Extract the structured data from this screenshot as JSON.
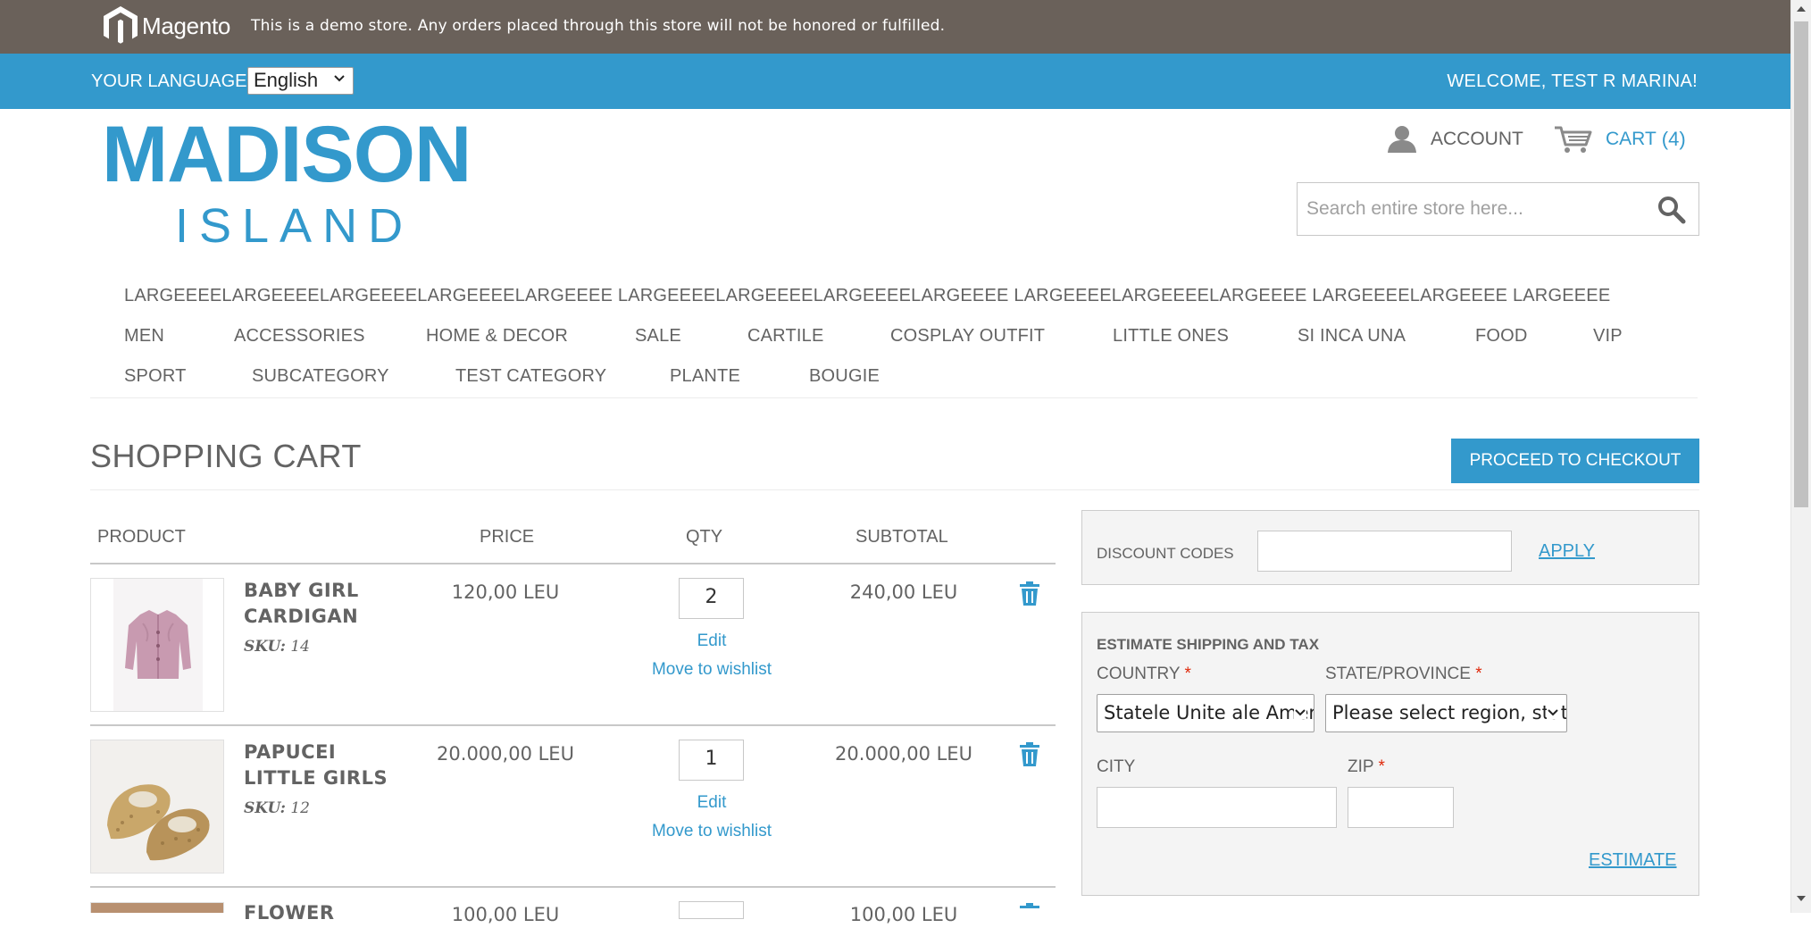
{
  "demo_notice": {
    "logo_text": "Magento",
    "message": "This is a demo store. Any orders placed through this store will not be honored or fulfilled."
  },
  "language_bar": {
    "label": "YOUR LANGUAGE:",
    "selected_language": "English",
    "welcome": "WELCOME, TEST R MARINA!"
  },
  "header": {
    "logo_line1": "MADISON",
    "logo_line2": "ISLAND",
    "account_label": "ACCOUNT",
    "cart_label": "CART",
    "cart_count": "(4)",
    "search_placeholder": "Search entire store here..."
  },
  "nav": {
    "items": [
      "LARGEEEELARGEEEELARGEEEELARGEEEELARGEEEE LARGEEEELARGEEEELARGEEEELARGEEEE LARGEEEELARGEEEELARGEEEE LARGEEEELARGEEEE LARGEEEE",
      "MEN",
      "ACCESSORIES",
      "HOME & DECOR",
      "SALE",
      "CARTILE",
      "COSPLAY OUTFIT",
      "LITTLE ONES",
      "SI INCA UNA",
      "FOOD",
      "VIP",
      "SPORT",
      "SUBCATEGORY",
      "TEST CATEGORY",
      "PLANTE",
      "BOUGIE"
    ]
  },
  "page": {
    "title": "SHOPPING CART",
    "checkout_button": "PROCEED TO CHECKOUT"
  },
  "cart": {
    "columns": [
      "PRODUCT",
      "PRICE",
      "QTY",
      "SUBTOTAL"
    ],
    "edit_label": "Edit",
    "wishlist_label": "Move to wishlist",
    "sku_label": "SKU:",
    "items": [
      {
        "name": "BABY GIRL CARDIGAN",
        "sku": "14",
        "price": "120,00 LEU",
        "qty": "2",
        "subtotal": "240,00 LEU"
      },
      {
        "name": "PAPUCEI LITTLE GIRLS",
        "sku": "12",
        "price": "20.000,00 LEU",
        "qty": "1",
        "subtotal": "20.000,00 LEU"
      },
      {
        "name": "FLOWER",
        "sku": "",
        "price": "100,00 LEU",
        "qty": "",
        "subtotal": "100,00 LEU"
      }
    ]
  },
  "discount": {
    "label": "DISCOUNT CODES",
    "apply": "APPLY"
  },
  "shipping": {
    "title": "ESTIMATE SHIPPING AND TAX",
    "country_label": "COUNTRY",
    "country_value": "Statele Unite ale Americii",
    "state_label": "STATE/PROVINCE",
    "state_value": "Please select region, state or province",
    "city_label": "CITY",
    "zip_label": "ZIP",
    "required_mark": "*",
    "estimate": "ESTIMATE"
  },
  "colors": {
    "brand_blue": "#3399cc",
    "demo_bar": "#6a615a",
    "text": "#636363",
    "required": "#df280a"
  }
}
